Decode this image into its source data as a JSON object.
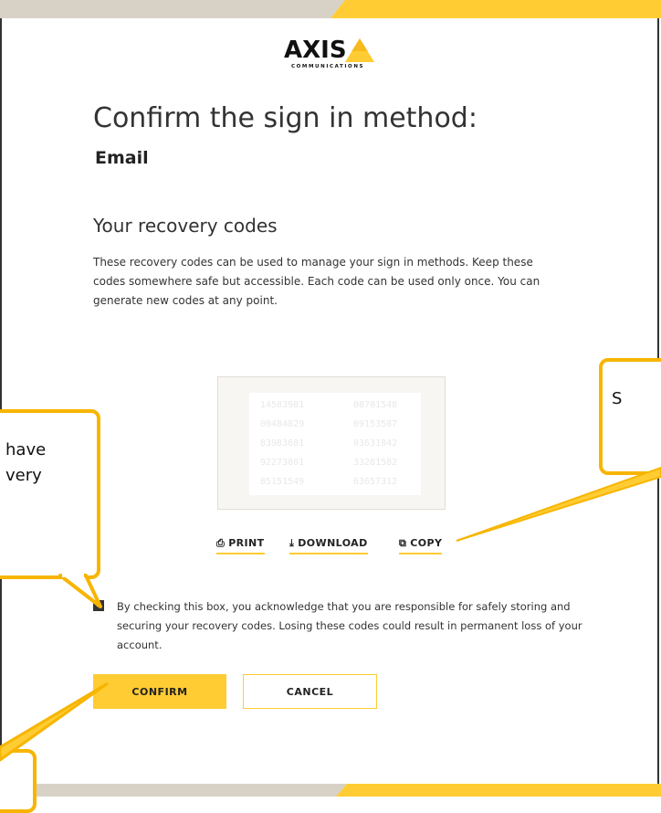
{
  "logo": {
    "brand": "AXIS",
    "sub": "COMMUNICATIONS"
  },
  "page": {
    "title": "Confirm the sign in method:",
    "method": "Email"
  },
  "recovery": {
    "heading": "Your recovery codes",
    "description": "These recovery codes can be used to manage your sign in methods. Keep these codes somewhere safe but accessible. Each code can be used only once. You can generate new codes at any point.",
    "codes": [
      "14583981",
      "08701548",
      "00484829",
      "09153587",
      "83983681",
      "03631842",
      "92273801",
      "33281582",
      "85151549",
      "63657312"
    ]
  },
  "actions": {
    "print": "PRINT",
    "download": "DOWNLOAD",
    "copy": "COPY"
  },
  "acknowledge": {
    "checked": true,
    "text": "By checking this box, you acknowledge that you are responsible for safely storing and securing your recovery codes. Losing these codes could result in permanent loss of your account."
  },
  "buttons": {
    "confirm": "CONFIRM",
    "cancel": "CANCEL"
  },
  "callouts": {
    "left_line1": "have",
    "left_line2": "very",
    "right_line1": "S"
  },
  "colors": {
    "accent": "#ffcc33",
    "callout_border": "#f7b500"
  }
}
